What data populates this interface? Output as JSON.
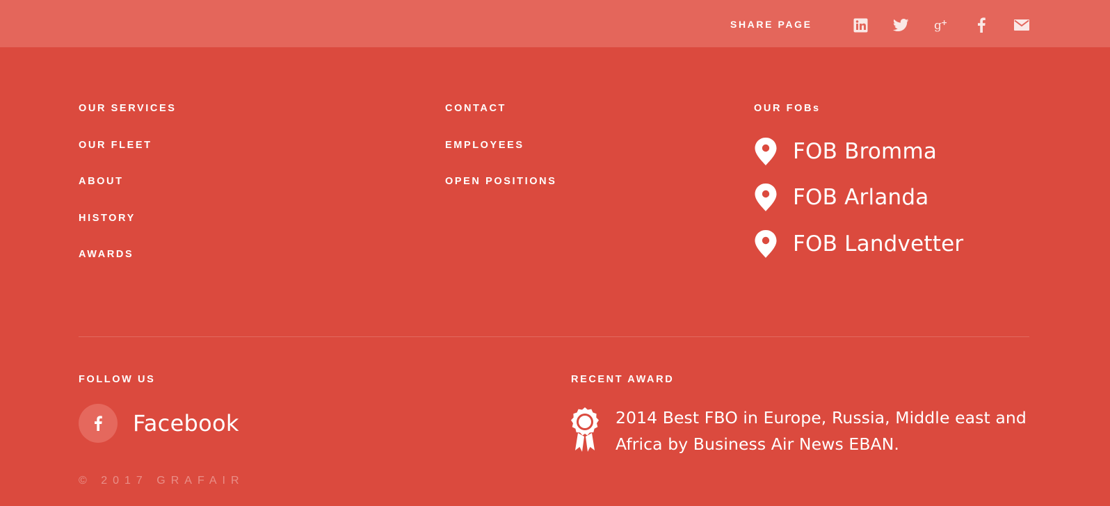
{
  "share": {
    "label": "SHARE PAGE",
    "icons": [
      "linkedin-icon",
      "twitter-icon",
      "google-plus-icon",
      "facebook-icon",
      "mail-icon"
    ]
  },
  "nav_col1": {
    "items": [
      {
        "label": "OUR SERVICES"
      },
      {
        "label": "OUR FLEET"
      },
      {
        "label": "ABOUT"
      },
      {
        "label": "HISTORY"
      },
      {
        "label": "AWARDS"
      }
    ]
  },
  "nav_col2": {
    "items": [
      {
        "label": "CONTACT"
      },
      {
        "label": "EMPLOYEES"
      },
      {
        "label": "OPEN POSITIONS"
      }
    ]
  },
  "fobs": {
    "heading": "OUR FOBs",
    "items": [
      {
        "label": "FOB Bromma",
        "icon": "map-pin-icon"
      },
      {
        "label": "FOB Arlanda",
        "icon": "map-pin-icon"
      },
      {
        "label": "FOB Landvetter",
        "icon": "map-pin-icon"
      }
    ]
  },
  "follow": {
    "heading": "FOLLOW US",
    "facebook_label": "Facebook",
    "icon": "facebook-icon"
  },
  "award": {
    "heading": "RECENT AWARD",
    "text": "2014 Best FBO in Europe, Russia, Middle east and Africa by Business Air News EBAN.",
    "icon": "award-ribbon-icon"
  },
  "copyright": "© 2017 GRAFAIR",
  "colors": {
    "background": "#db4a3e",
    "share_bar": "#e4665b",
    "text": "#ffffff"
  }
}
